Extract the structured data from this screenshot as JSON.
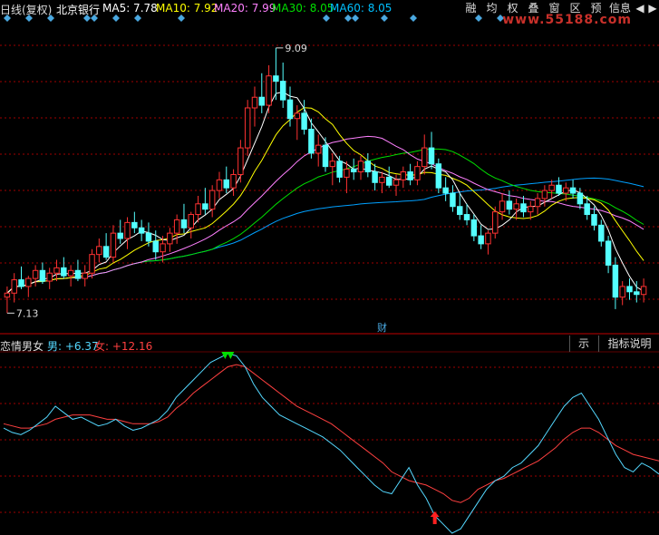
{
  "header": {
    "period": "日线(复权)",
    "stock": "北京银行",
    "ma5": "MA5: 7.78",
    "ma10": "MA10: 7.92",
    "ma20": "MA20: 7.99",
    "ma30": "MA30: 8.05",
    "ma60": "MA60: 8.05"
  },
  "toolbar": [
    "融",
    "均",
    "权",
    "叠",
    "窗",
    "区",
    "预",
    "信息"
  ],
  "nav": {
    "left": "◀",
    "right": "▶"
  },
  "watermark": "www.55188.com",
  "annotations": {
    "high": "9.09",
    "low": "7.13",
    "fin_marker": "财"
  },
  "indicator": {
    "name": "恋情男女",
    "male_label": "男: +6.37",
    "female_label": "女: +12.16",
    "btn_partial": "示",
    "btn_help": "指标说明"
  },
  "colors": {
    "bg": "#000000",
    "up": "#ff3232",
    "down": "#54ffff",
    "ma5": "#ffffff",
    "ma10": "#ffff00",
    "ma20": "#ff80ff",
    "ma30": "#00e000",
    "ma60": "#00a0ff",
    "male": "#54d8ff",
    "female": "#ff4040",
    "grid": "#a00000"
  },
  "chart_data": [
    {
      "type": "candlestick",
      "title": "北京银行 日线(复权)",
      "high_label": 9.09,
      "low_label": 7.13,
      "ylim": [
        7.0,
        9.3
      ],
      "candles": [
        [
          7.22,
          7.3,
          7.1,
          7.25
        ],
        [
          7.25,
          7.4,
          7.18,
          7.35
        ],
        [
          7.35,
          7.45,
          7.28,
          7.3
        ],
        [
          7.3,
          7.38,
          7.22,
          7.36
        ],
        [
          7.36,
          7.46,
          7.3,
          7.42
        ],
        [
          7.42,
          7.48,
          7.32,
          7.34
        ],
        [
          7.34,
          7.44,
          7.28,
          7.4
        ],
        [
          7.4,
          7.5,
          7.34,
          7.44
        ],
        [
          7.44,
          7.52,
          7.36,
          7.38
        ],
        [
          7.38,
          7.46,
          7.3,
          7.42
        ],
        [
          7.42,
          7.5,
          7.34,
          7.36
        ],
        [
          7.36,
          7.46,
          7.3,
          7.4
        ],
        [
          7.4,
          7.58,
          7.36,
          7.54
        ],
        [
          7.54,
          7.66,
          7.48,
          7.6
        ],
        [
          7.6,
          7.7,
          7.5,
          7.52
        ],
        [
          7.52,
          7.76,
          7.48,
          7.7
        ],
        [
          7.7,
          7.8,
          7.62,
          7.66
        ],
        [
          7.66,
          7.82,
          7.58,
          7.78
        ],
        [
          7.78,
          7.86,
          7.7,
          7.74
        ],
        [
          7.74,
          7.8,
          7.64,
          7.7
        ],
        [
          7.7,
          7.78,
          7.6,
          7.64
        ],
        [
          7.64,
          7.72,
          7.5,
          7.56
        ],
        [
          7.56,
          7.68,
          7.48,
          7.62
        ],
        [
          7.62,
          7.74,
          7.56,
          7.7
        ],
        [
          7.7,
          7.84,
          7.62,
          7.8
        ],
        [
          7.8,
          7.92,
          7.7,
          7.74
        ],
        [
          7.74,
          7.86,
          7.66,
          7.84
        ],
        [
          7.84,
          7.98,
          7.78,
          7.92
        ],
        [
          7.92,
          8.04,
          7.84,
          7.88
        ],
        [
          7.88,
          8.06,
          7.82,
          8.02
        ],
        [
          8.02,
          8.16,
          7.96,
          8.1
        ],
        [
          8.1,
          8.2,
          8.0,
          8.04
        ],
        [
          8.04,
          8.18,
          7.98,
          8.14
        ],
        [
          8.14,
          8.4,
          8.08,
          8.34
        ],
        [
          8.34,
          8.7,
          8.28,
          8.64
        ],
        [
          8.64,
          8.8,
          8.5,
          8.72
        ],
        [
          8.72,
          8.9,
          8.6,
          8.66
        ],
        [
          8.66,
          8.96,
          8.6,
          8.88
        ],
        [
          8.88,
          9.09,
          8.7,
          8.84
        ],
        [
          8.84,
          8.98,
          8.64,
          8.7
        ],
        [
          8.7,
          8.8,
          8.5,
          8.56
        ],
        [
          8.56,
          8.66,
          8.4,
          8.6
        ],
        [
          8.6,
          8.7,
          8.44,
          8.48
        ],
        [
          8.48,
          8.56,
          8.26,
          8.3
        ],
        [
          8.3,
          8.44,
          8.2,
          8.36
        ],
        [
          8.36,
          8.42,
          8.16,
          8.2
        ],
        [
          8.2,
          8.3,
          8.06,
          8.24
        ],
        [
          8.24,
          8.28,
          8.08,
          8.12
        ],
        [
          8.12,
          8.24,
          8.0,
          8.18
        ],
        [
          8.18,
          8.26,
          8.1,
          8.16
        ],
        [
          8.16,
          8.28,
          8.1,
          8.24
        ],
        [
          8.24,
          8.3,
          8.12,
          8.16
        ],
        [
          8.16,
          8.22,
          8.02,
          8.08
        ],
        [
          8.08,
          8.16,
          8.0,
          8.12
        ],
        [
          8.12,
          8.2,
          8.04,
          8.06
        ],
        [
          8.06,
          8.14,
          7.98,
          8.1
        ],
        [
          8.1,
          8.2,
          8.04,
          8.16
        ],
        [
          8.16,
          8.22,
          8.06,
          8.1
        ],
        [
          8.1,
          8.24,
          8.06,
          8.2
        ],
        [
          8.2,
          8.44,
          8.14,
          8.34
        ],
        [
          8.34,
          8.46,
          8.18,
          8.22
        ],
        [
          8.22,
          8.26,
          8.0,
          8.04
        ],
        [
          8.04,
          8.12,
          7.94,
          8.0
        ],
        [
          8.0,
          8.06,
          7.86,
          7.9
        ],
        [
          7.9,
          8.0,
          7.8,
          7.84
        ],
        [
          7.84,
          7.92,
          7.76,
          7.8
        ],
        [
          7.8,
          7.84,
          7.64,
          7.68
        ],
        [
          7.68,
          7.76,
          7.58,
          7.62
        ],
        [
          7.62,
          7.72,
          7.54,
          7.7
        ],
        [
          7.7,
          7.9,
          7.66,
          7.86
        ],
        [
          7.86,
          8.0,
          7.8,
          7.94
        ],
        [
          7.94,
          8.02,
          7.84,
          7.88
        ],
        [
          7.88,
          7.96,
          7.8,
          7.92
        ],
        [
          7.92,
          7.98,
          7.82,
          7.86
        ],
        [
          7.86,
          7.94,
          7.8,
          7.9
        ],
        [
          7.9,
          8.0,
          7.84,
          7.96
        ],
        [
          7.96,
          8.06,
          7.9,
          8.02
        ],
        [
          8.02,
          8.1,
          7.96,
          8.06
        ],
        [
          8.06,
          8.12,
          7.98,
          8.0
        ],
        [
          8.0,
          8.08,
          7.94,
          8.04
        ],
        [
          8.04,
          8.1,
          7.96,
          8.0
        ],
        [
          8.0,
          8.04,
          7.88,
          7.92
        ],
        [
          7.92,
          7.98,
          7.8,
          7.84
        ],
        [
          7.84,
          7.9,
          7.72,
          7.76
        ],
        [
          7.76,
          7.8,
          7.6,
          7.64
        ],
        [
          7.64,
          7.68,
          7.4,
          7.46
        ],
        [
          7.46,
          7.52,
          7.13,
          7.22
        ],
        [
          7.22,
          7.34,
          7.16,
          7.3
        ],
        [
          7.3,
          7.36,
          7.2,
          7.26
        ],
        [
          7.26,
          7.34,
          7.18,
          7.24
        ],
        [
          7.24,
          7.36,
          7.18,
          7.3
        ]
      ],
      "indicator_series": [
        {
          "name": "男",
          "values": [
            48,
            46,
            45,
            47,
            50,
            53,
            58,
            55,
            52,
            53,
            51,
            49,
            50,
            52,
            49,
            47,
            48,
            50,
            52,
            56,
            62,
            66,
            70,
            74,
            78,
            80,
            82,
            81,
            76,
            68,
            62,
            58,
            54,
            52,
            50,
            48,
            46,
            44,
            41,
            38,
            34,
            30,
            26,
            22,
            19,
            18,
            24,
            30,
            22,
            16,
            8,
            4,
            0,
            2,
            8,
            14,
            20,
            24,
            26,
            30,
            32,
            36,
            40,
            46,
            52,
            58,
            62,
            64,
            58,
            52,
            44,
            36,
            30,
            28,
            32,
            30,
            27
          ],
          "last_value": 6.37
        },
        {
          "name": "女",
          "values": [
            50,
            49,
            48,
            48,
            49,
            50,
            52,
            53,
            54,
            54,
            54,
            53,
            52,
            52,
            51,
            50,
            50,
            50,
            51,
            53,
            57,
            60,
            64,
            67,
            70,
            73,
            76,
            77,
            76,
            73,
            70,
            67,
            64,
            61,
            58,
            56,
            54,
            52,
            50,
            47,
            44,
            41,
            38,
            35,
            32,
            28,
            26,
            24,
            23,
            22,
            20,
            18,
            15,
            14,
            16,
            20,
            22,
            24,
            25,
            27,
            29,
            31,
            33,
            36,
            39,
            43,
            46,
            48,
            48,
            46,
            43,
            40,
            38,
            36,
            35,
            34,
            33
          ],
          "last_value": 12.16
        }
      ]
    }
  ]
}
